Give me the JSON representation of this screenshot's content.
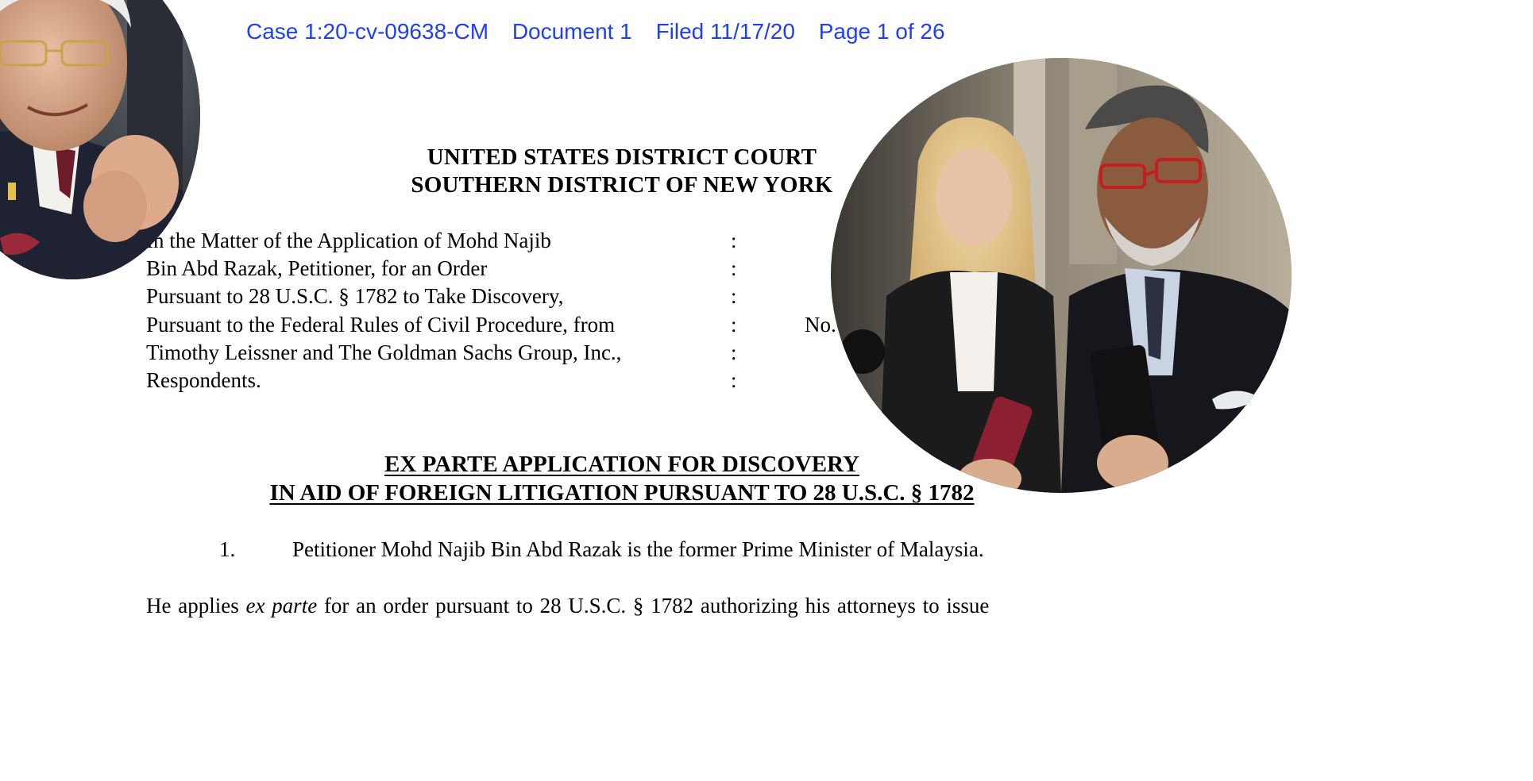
{
  "header": {
    "case": "Case 1:20-cv-09638-CM",
    "document": "Document 1",
    "filed": "Filed 11/17/20",
    "page": "Page 1 of 26"
  },
  "court": {
    "line1": "UNITED STATES DISTRICT COURT",
    "line2": "SOUTHERN DISTRICT OF NEW YORK"
  },
  "caption": {
    "lines": [
      "In the Matter of the Application of Mohd Najib",
      "Bin Abd Razak, Petitioner, for an Order",
      "Pursuant to 28 U.S.C. § 1782 to Take Discovery,",
      "Pursuant to the Federal Rules of Civil Procedure, from",
      "Timothy Leissner and The Goldman Sachs Group, Inc.,",
      "Respondents."
    ],
    "colon": ":",
    "case_no": "No."
  },
  "application": {
    "title1": "EX PARTE APPLICATION FOR DISCOVERY",
    "title2": "IN AID OF FOREIGN LITIGATION PURSUANT TO 28 U.S.C. § 1782"
  },
  "paragraph1": {
    "number": "1.",
    "text": "Petitioner Mohd Najib Bin Abd Razak is the former Prime Minister of Malaysia.",
    "cont_before": "He applies ",
    "cont_italic": "ex parte",
    "cont_after": " for an order pursuant to 28 U.S.C. § 1782 authorizing his attorneys to issue"
  },
  "colors": {
    "header_blue": "#1f3ff5"
  }
}
